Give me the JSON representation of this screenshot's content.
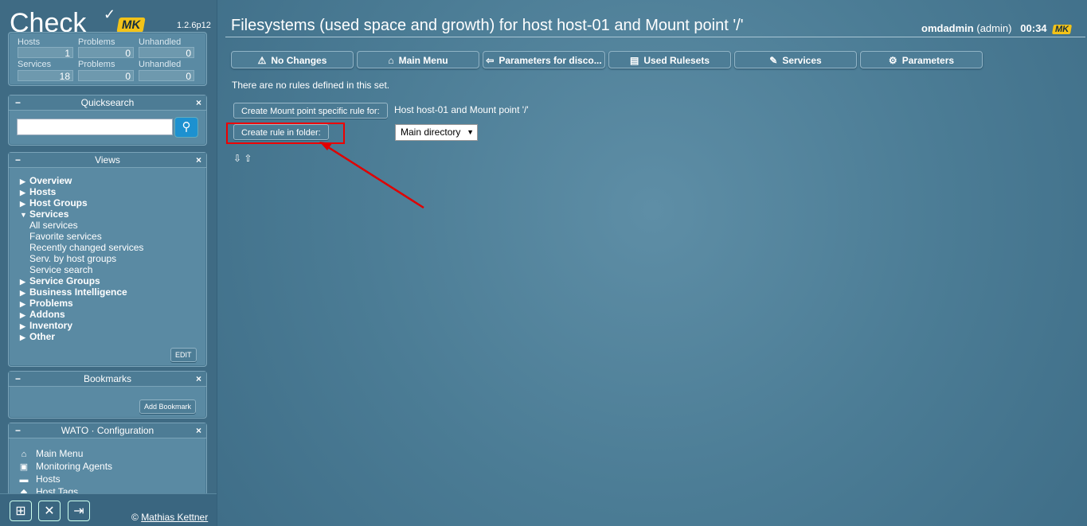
{
  "sidebar": {
    "logo": "Check",
    "logo_badge": "MK",
    "version": "1.2.6p12",
    "stats": {
      "header_labels": [
        "Hosts",
        "Problems",
        "Unhandled"
      ],
      "host_values": [
        "1",
        "0",
        "0"
      ],
      "service_labels": [
        "Services",
        "Problems",
        "Unhandled"
      ],
      "service_values": [
        "18",
        "0",
        "0"
      ]
    },
    "quicksearch": {
      "title": "Quicksearch",
      "placeholder": ""
    },
    "views": {
      "title": "Views",
      "items": [
        {
          "label": "Overview",
          "arrow": "▶"
        },
        {
          "label": "Hosts",
          "arrow": "▶"
        },
        {
          "label": "Host Groups",
          "arrow": "▶"
        },
        {
          "label": "Services",
          "arrow": "▼"
        },
        {
          "label": "All services"
        },
        {
          "label": "Favorite services"
        },
        {
          "label": "Recently changed services"
        },
        {
          "label": "Serv. by host groups"
        },
        {
          "label": "Service search"
        },
        {
          "label": "Service Groups",
          "arrow": "▶"
        },
        {
          "label": "Business Intelligence",
          "arrow": "▶"
        },
        {
          "label": "Problems",
          "arrow": "▶"
        },
        {
          "label": "Addons",
          "arrow": "▶"
        },
        {
          "label": "Inventory",
          "arrow": "▶"
        },
        {
          "label": "Other",
          "arrow": "▶"
        }
      ],
      "edit_label": "EDIT"
    },
    "bookmarks": {
      "title": "Bookmarks",
      "add_label": "Add Bookmark"
    },
    "wato": {
      "title": "WATO · Configuration",
      "items": [
        "Main Menu",
        "Monitoring Agents",
        "Hosts",
        "Host Tags"
      ]
    },
    "footer": {
      "copyright_symbol": "©",
      "copyright_link": "Mathias Kettner"
    }
  },
  "header": {
    "title": "Filesystems (used space and growth) for host host-01 and Mount point '/'",
    "user": "omdadmin",
    "role": "(admin)",
    "time": "00:34",
    "badge": "MK"
  },
  "toolbar": {
    "buttons": [
      "No Changes",
      "Main Menu",
      "Parameters for disco...",
      "Used Rulesets",
      "Services",
      "Parameters"
    ]
  },
  "content": {
    "no_rules_text": "There are no rules defined in this set.",
    "create_specific_label": "Create Mount point specific rule for:",
    "host_mount_label": "Host host-01 and Mount point '/'",
    "create_folder_label": "Create rule in folder:",
    "folder_selected": "Main directory"
  },
  "colors": {
    "highlight": "#e00000",
    "accent_yellow": "#f3c318",
    "search_button": "#1d91d0"
  }
}
